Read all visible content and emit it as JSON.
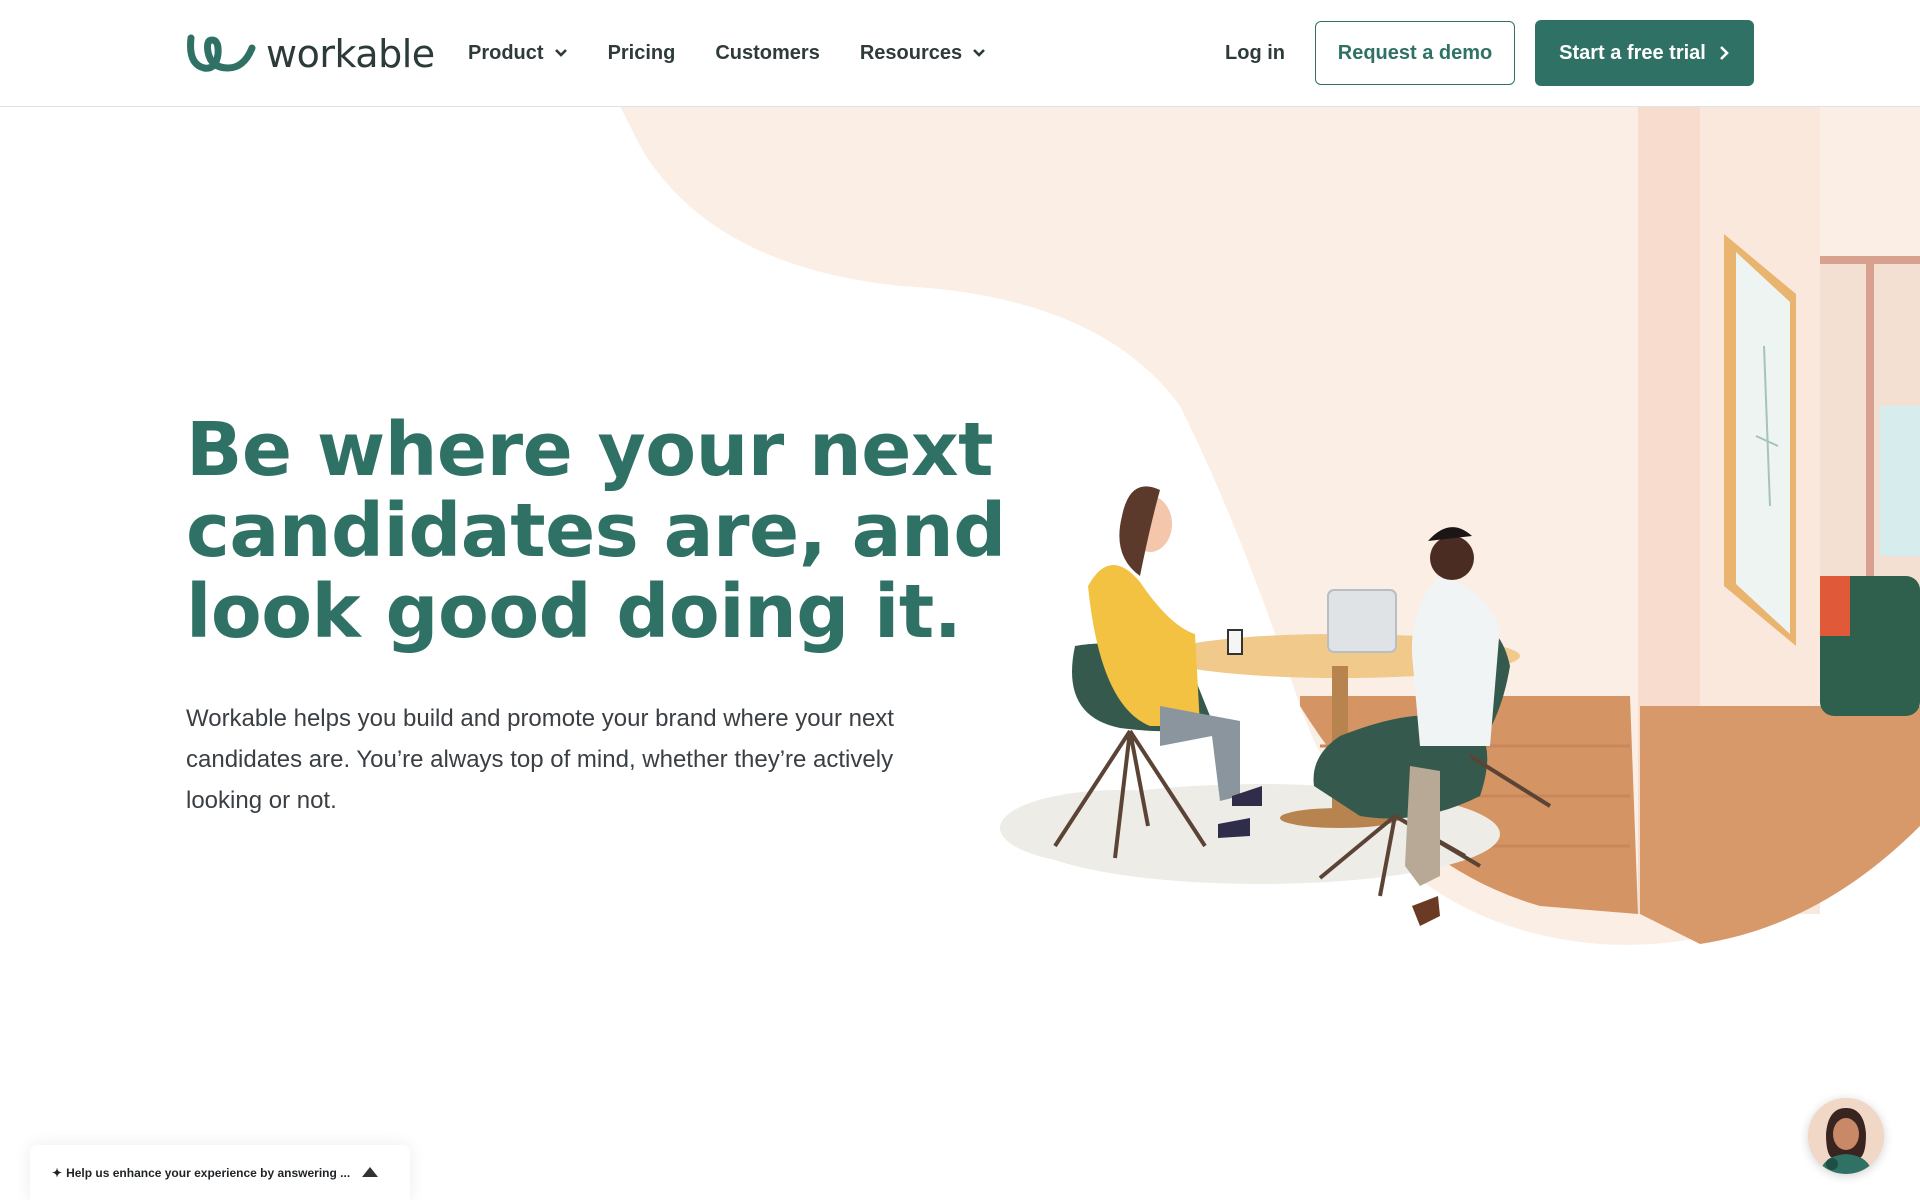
{
  "header": {
    "logo_text": "workable",
    "nav": [
      {
        "label": "Product",
        "dropdown": true
      },
      {
        "label": "Pricing",
        "dropdown": false
      },
      {
        "label": "Customers",
        "dropdown": false
      },
      {
        "label": "Resources",
        "dropdown": true
      }
    ],
    "login_label": "Log in",
    "demo_label": "Request a demo",
    "trial_label": "Start a free trial"
  },
  "hero": {
    "headline": "Be where your next candidates are, and look good doing it.",
    "subtext": "Workable helps you build and promote your brand where your next candidates are. You’re always top of mind, whether they’re actively looking or not."
  },
  "feedback": {
    "text": "Help us enhance your experience by answering ..."
  },
  "colors": {
    "brand_green": "#2f7265",
    "peach": "#fbeee4",
    "floor": "#d49464",
    "chair": "#355a4d"
  },
  "icons": {
    "logo": "workable-logo-icon",
    "dropdown": "chevron-down-icon",
    "trial_arrow": "chevron-right-icon",
    "feedback_spark": "sparkle-icon",
    "feedback_toggle": "triangle-up-icon",
    "chat": "chat-agent-avatar"
  }
}
